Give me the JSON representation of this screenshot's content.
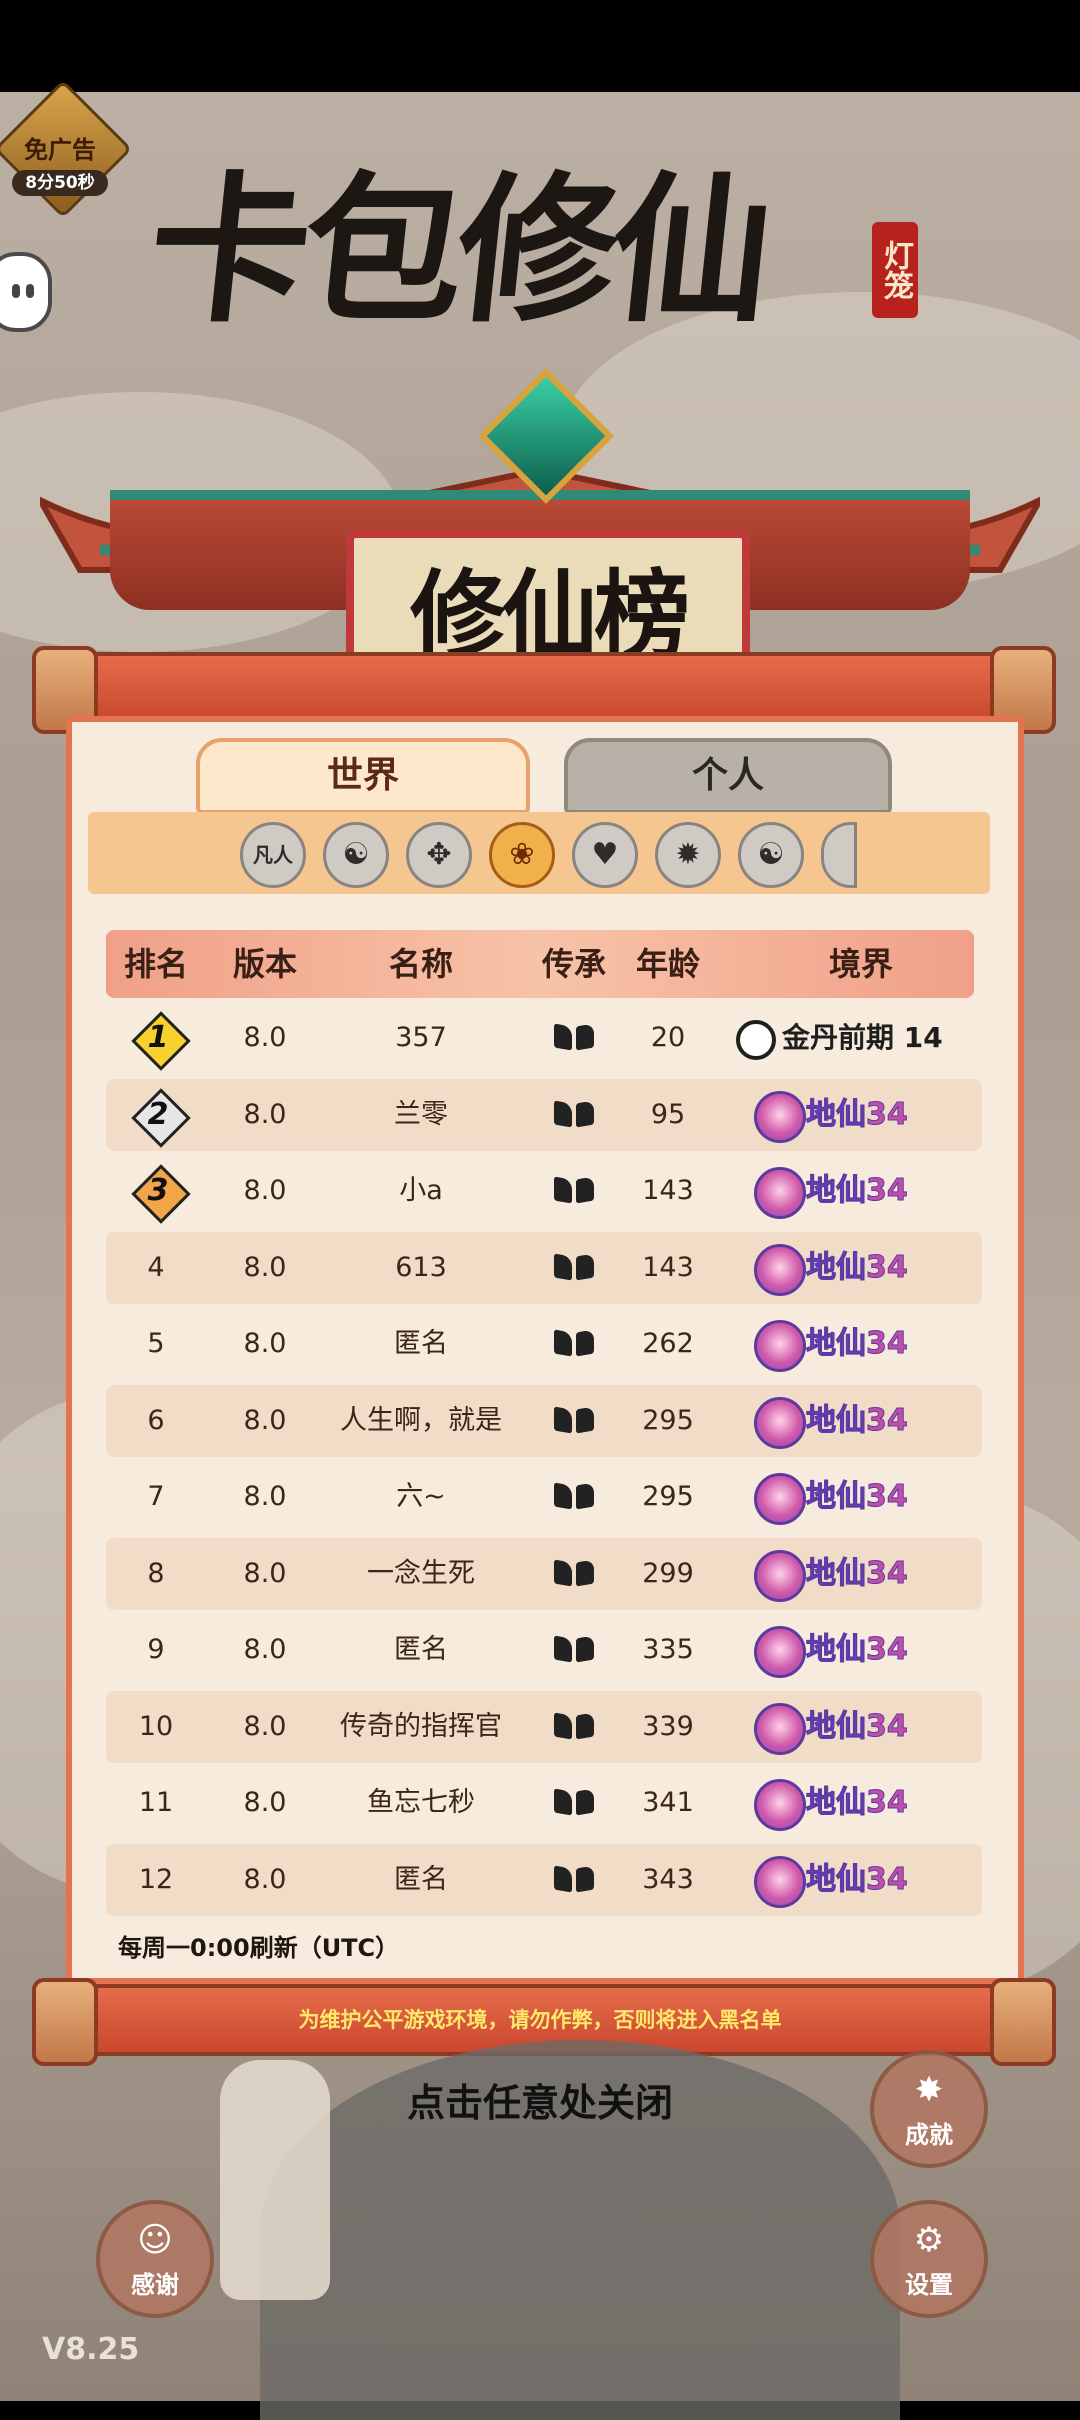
{
  "ad_badge": {
    "label": "免广告",
    "timer": "8分50秒"
  },
  "game_title": "卡包修仙",
  "title_seal": "灯笼",
  "board_title": "修仙榜",
  "tabs": {
    "world": "世界",
    "personal": "个人"
  },
  "filters": {
    "first_label": "凡人",
    "icons": [
      "mortal",
      "yin-yang-icon",
      "sword-icon",
      "lotus-icon",
      "heart-icon",
      "fire-icon",
      "taiji-icon",
      "more-icon"
    ]
  },
  "table": {
    "headers": {
      "rank": "排名",
      "version": "版本",
      "name": "名称",
      "inheritance": "传承",
      "age": "年龄",
      "realm": "境界"
    },
    "rows": [
      {
        "rank": "1",
        "version": "8.0",
        "name": "357",
        "age": "20",
        "realm": "金丹前期 14"
      },
      {
        "rank": "2",
        "version": "8.0",
        "name": "兰零",
        "age": "95",
        "realm": "地仙34"
      },
      {
        "rank": "3",
        "version": "8.0",
        "name": "小a",
        "age": "143",
        "realm": "地仙34"
      },
      {
        "rank": "4",
        "version": "8.0",
        "name": "613",
        "age": "143",
        "realm": "地仙34"
      },
      {
        "rank": "5",
        "version": "8.0",
        "name": "匿名",
        "age": "262",
        "realm": "地仙34"
      },
      {
        "rank": "6",
        "version": "8.0",
        "name": "人生啊，就是",
        "age": "295",
        "realm": "地仙34"
      },
      {
        "rank": "7",
        "version": "8.0",
        "name": "六~",
        "age": "295",
        "realm": "地仙34"
      },
      {
        "rank": "8",
        "version": "8.0",
        "name": "一念生死",
        "age": "299",
        "realm": "地仙34"
      },
      {
        "rank": "9",
        "version": "8.0",
        "name": "匿名",
        "age": "335",
        "realm": "地仙34"
      },
      {
        "rank": "10",
        "version": "8.0",
        "name": "传奇的指挥官",
        "age": "339",
        "realm": "地仙34"
      },
      {
        "rank": "11",
        "version": "8.0",
        "name": "鱼忘七秒",
        "age": "341",
        "realm": "地仙34"
      },
      {
        "rank": "12",
        "version": "8.0",
        "name": "匿名",
        "age": "343",
        "realm": "地仙34"
      }
    ]
  },
  "refresh_note": "每周一0:00刷新（UTC）",
  "warning": "为维护公平游戏环境，请勿作弊，否则将进入黑名单",
  "close_hint": "点击任意处关闭",
  "buttons": {
    "achievements": "成就",
    "thanks": "感谢",
    "settings": "设置"
  },
  "version": "V8.25",
  "colors": {
    "panel": "#f6ebdc",
    "accent": "#e4734f",
    "realm_pink": "#c24fa6"
  }
}
